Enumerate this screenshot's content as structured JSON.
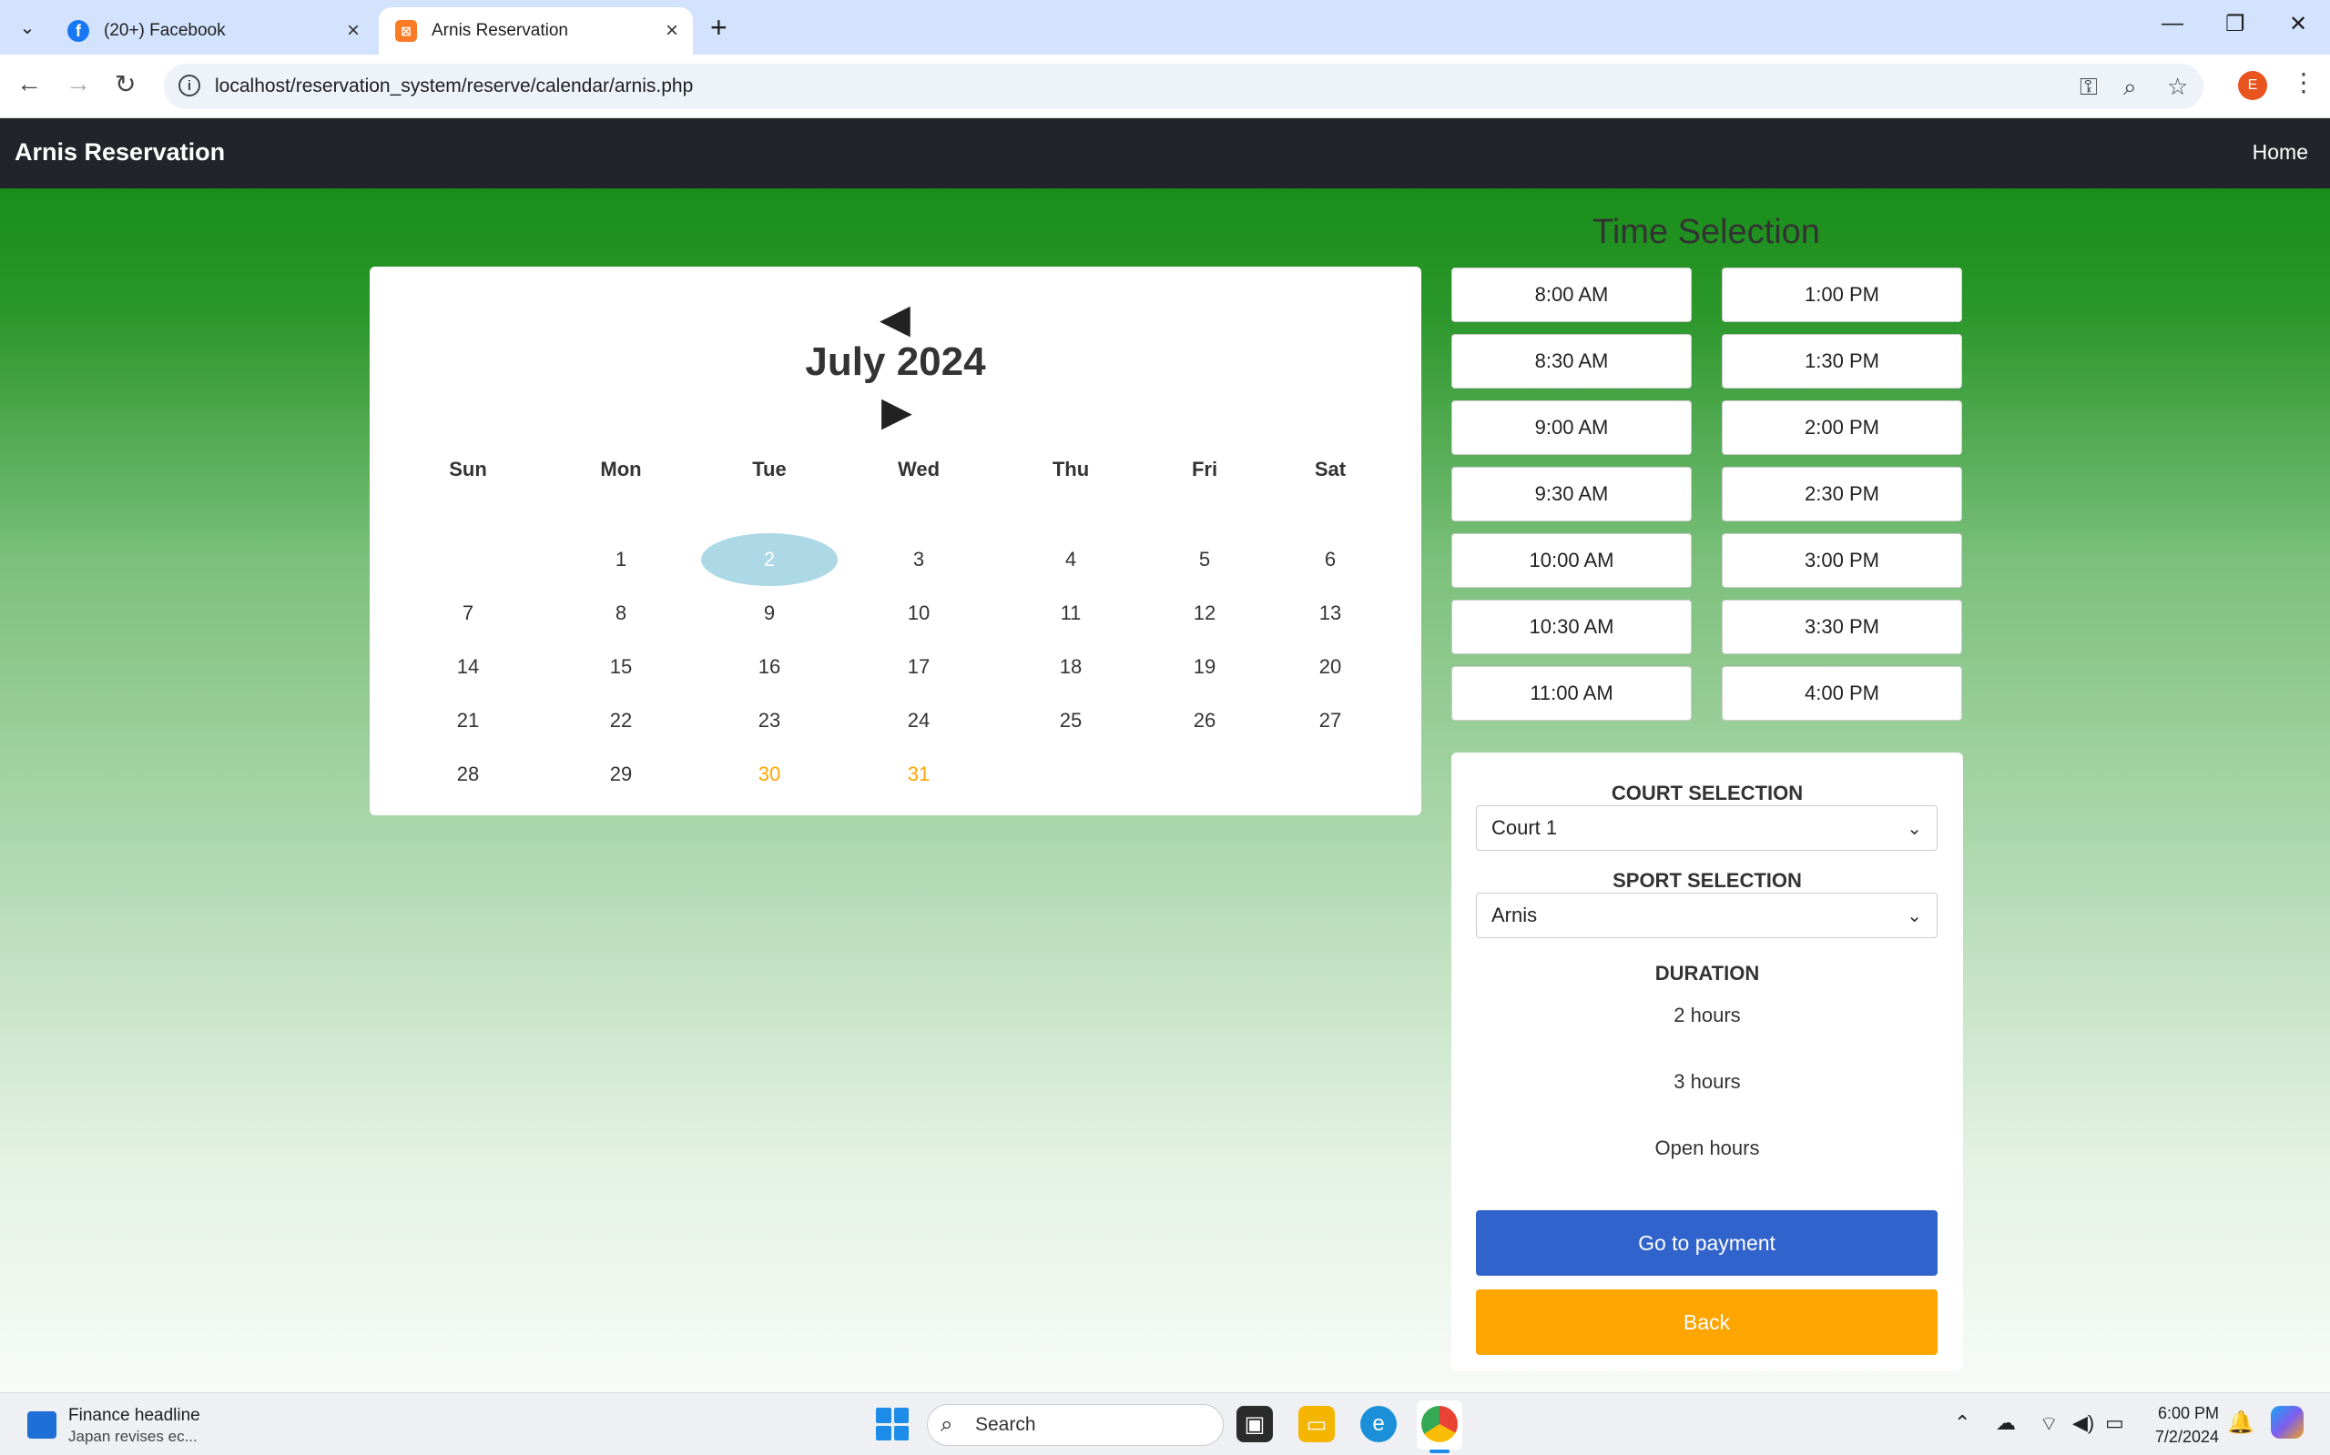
{
  "browser": {
    "tabs": [
      {
        "title": "(20+) Facebook",
        "favicon": "facebook-icon",
        "active": false
      },
      {
        "title": "Arnis Reservation",
        "favicon": "xampp-icon",
        "active": true
      }
    ],
    "url": "localhost/reservation_system/reserve/calendar/arnis.php",
    "profile_initial": "E"
  },
  "nav": {
    "brand": "Arnis Reservation",
    "home": "Home"
  },
  "calendar": {
    "month_label": "July 2024",
    "prev_arrow": "◀",
    "next_arrow": "▶",
    "weekdays": [
      "Sun",
      "Mon",
      "Tue",
      "Wed",
      "Thu",
      "Fri",
      "Sat"
    ],
    "weeks": [
      [
        "",
        "1",
        "2",
        "3",
        "4",
        "5",
        "6"
      ],
      [
        "7",
        "8",
        "9",
        "10",
        "11",
        "12",
        "13"
      ],
      [
        "14",
        "15",
        "16",
        "17",
        "18",
        "19",
        "20"
      ],
      [
        "21",
        "22",
        "23",
        "24",
        "25",
        "26",
        "27"
      ],
      [
        "28",
        "29",
        "30",
        "31",
        "",
        "",
        ""
      ]
    ],
    "selected_day": "2",
    "highlighted_days": [
      "30",
      "31"
    ],
    "colors": {
      "selected_bg": "#add8e6",
      "highlight": "#ffa500"
    }
  },
  "time_selection": {
    "title": "Time Selection",
    "left_column": [
      "8:00 AM",
      "8:30 AM",
      "9:00 AM",
      "9:30 AM",
      "10:00 AM",
      "10:30 AM",
      "11:00 AM"
    ],
    "right_column": [
      "1:00 PM",
      "1:30 PM",
      "2:00 PM",
      "2:30 PM",
      "3:00 PM",
      "3:30 PM",
      "4:00 PM"
    ]
  },
  "panel": {
    "court_label": "COURT SELECTION",
    "court_value": "Court 1",
    "sport_label": "SPORT SELECTION",
    "sport_value": "Arnis",
    "duration_label": "DURATION",
    "durations": [
      "2 hours",
      "3 hours",
      "Open hours"
    ],
    "payment_button": "Go to payment",
    "back_button": "Back",
    "colors": {
      "payment": "#3063cc",
      "back": "#ffa500"
    }
  },
  "taskbar": {
    "widget_title": "Finance headline",
    "widget_subtitle": "Japan revises ec...",
    "search_placeholder": "Search",
    "time": "6:00 PM",
    "date": "7/2/2024"
  }
}
